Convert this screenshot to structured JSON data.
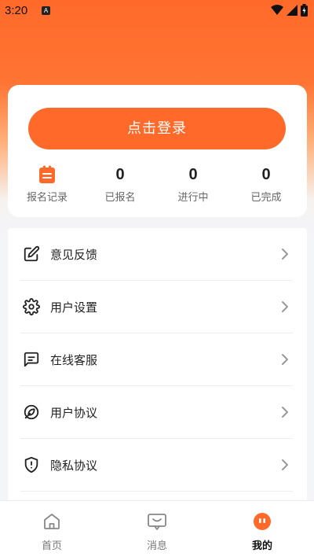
{
  "status_bar": {
    "time": "3:20",
    "app_badge": "A"
  },
  "login": {
    "button_label": "点击登录"
  },
  "stats": [
    {
      "value": "",
      "label": "报名记录",
      "icon": "clipboard-icon"
    },
    {
      "value": "0",
      "label": "已报名"
    },
    {
      "value": "0",
      "label": "进行中"
    },
    {
      "value": "0",
      "label": "已完成"
    }
  ],
  "menu": {
    "items": [
      {
        "label": "意见反馈",
        "icon": "edit-icon"
      },
      {
        "label": "用户设置",
        "icon": "gear-icon"
      },
      {
        "label": "在线客服",
        "icon": "chat-icon"
      },
      {
        "label": "用户协议",
        "icon": "shield-off-icon"
      },
      {
        "label": "隐私协议",
        "icon": "shield-alert-icon"
      }
    ]
  },
  "tabbar": {
    "tabs": [
      {
        "label": "首页",
        "icon": "home-icon"
      },
      {
        "label": "消息",
        "icon": "message-icon"
      },
      {
        "label": "我的",
        "icon": "profile-icon"
      }
    ],
    "active_index": 2
  },
  "colors": {
    "accent": "#ff6a2a",
    "background": "#f4f5f9"
  }
}
